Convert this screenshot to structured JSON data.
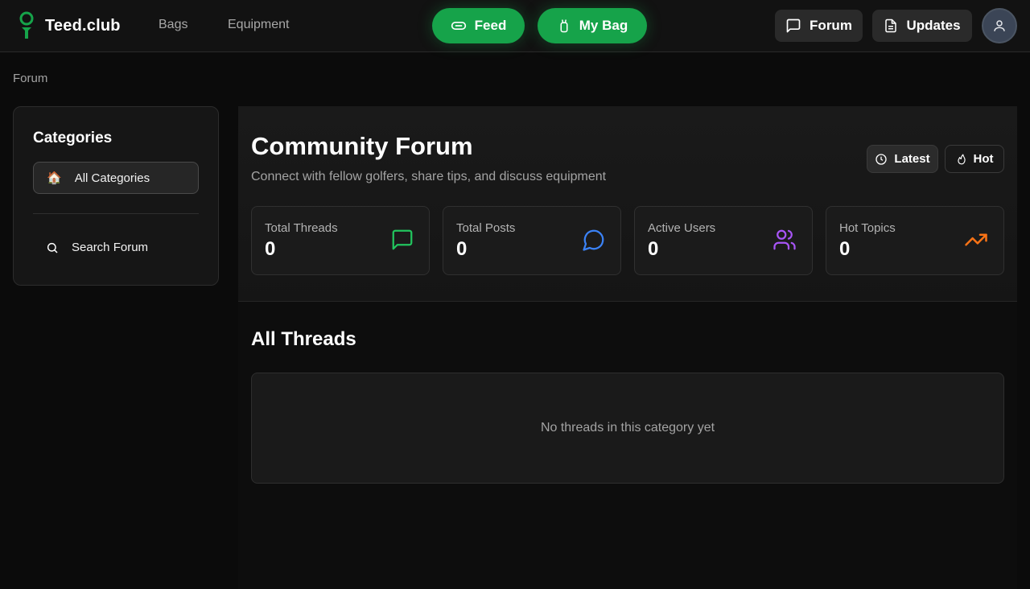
{
  "brand": {
    "name": "Teed.club",
    "accent": "#16a34a"
  },
  "nav": {
    "links": [
      "Bags",
      "Equipment"
    ],
    "feed_label": "Feed",
    "mybag_label": "My Bag",
    "forum_label": "Forum",
    "updates_label": "Updates"
  },
  "breadcrumb": "Forum",
  "sidebar": {
    "title": "Categories",
    "all_categories": "All Categories",
    "all_categories_icon": "🏠",
    "search_label": "Search Forum"
  },
  "hero": {
    "title": "Community Forum",
    "subtitle": "Connect with fellow golfers, share tips, and discuss equipment",
    "sort": {
      "latest": "Latest",
      "hot": "Hot"
    }
  },
  "stats": [
    {
      "label": "Total Threads",
      "value": "0",
      "icon": "message-square-icon",
      "color": "#22c55e"
    },
    {
      "label": "Total Posts",
      "value": "0",
      "icon": "message-circle-icon",
      "color": "#3b82f6"
    },
    {
      "label": "Active Users",
      "value": "0",
      "icon": "users-icon",
      "color": "#a855f7"
    },
    {
      "label": "Hot Topics",
      "value": "0",
      "icon": "trending-up-icon",
      "color": "#f97316"
    }
  ],
  "threads": {
    "title": "All Threads",
    "empty_message": "No threads in this category yet"
  }
}
